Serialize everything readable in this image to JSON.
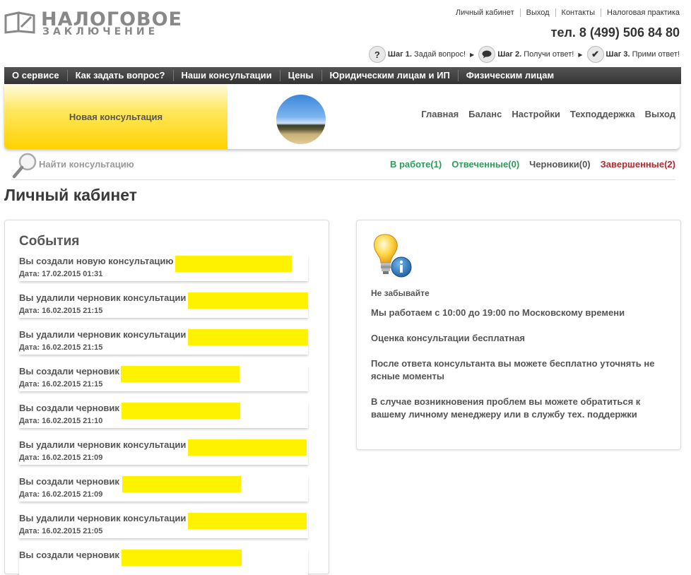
{
  "logo": {
    "line1": "НАЛОГОВОЕ",
    "line2": "ЗАКЛЮЧЕНИЕ",
    "icon": "book-pen-icon"
  },
  "top_links": [
    "Личный кабинет",
    "Выход",
    "Контакты",
    "Налоговая практика"
  ],
  "phone": "тел. 8 (499) 506 84 80",
  "steps": [
    {
      "icon": "question-icon",
      "glyph": "?",
      "label": "Шаг 1.",
      "text": "Задай вопрос!"
    },
    {
      "icon": "speech-bubble-icon",
      "glyph": "",
      "label": "Шаг 2.",
      "text": "Получи ответ!"
    },
    {
      "icon": "checkmark-icon",
      "glyph": "✔",
      "label": "Шаг 3.",
      "text": "Прими ответ!"
    }
  ],
  "main_menu": [
    "О сервисе",
    "Как задать вопрос?",
    "Наши консультации",
    "Цены",
    "Юридическим лицам и ИП",
    "Физическим лицам"
  ],
  "panel": {
    "new_consultation": "Новая консультация",
    "nav": [
      "Главная",
      "Баланс",
      "Настройки",
      "Техподдержка",
      "Выход"
    ]
  },
  "search": {
    "label": "Найти консультацию",
    "icon": "magnifier-icon"
  },
  "filters": {
    "in_work": "В работе(1)",
    "answered": "Отвеченные(0)",
    "drafts": "Черновики(0)",
    "completed": "Завершенные(2)"
  },
  "page_title": "Личный кабинет",
  "events": {
    "title": "События",
    "items": [
      {
        "text": "Вы создали новую консультацию",
        "date": "Дата: 17.02.2015 01:31"
      },
      {
        "text": "Вы удалили черновик консультации",
        "date": "Дата: 16.02.2015 21:15"
      },
      {
        "text": "Вы удалили черновик консультации",
        "date": "Дата: 16.02.2015 21:15"
      },
      {
        "text": "Вы создали черновик",
        "date": "Дата: 16.02.2015 21:15"
      },
      {
        "text": "Вы создали черновик",
        "date": "Дата: 16.02.2015 21:10"
      },
      {
        "text": "Вы удалили черновик консультации",
        "date": "Дата: 16.02.2015 21:09"
      },
      {
        "text": "Вы создали черновик",
        "date": "Дата: 16.02.2015 21:09"
      },
      {
        "text": "Вы удалили черновик консультации",
        "date": "Дата: 16.02.2015 21:05"
      },
      {
        "text": "Вы создали черновик",
        "date": ""
      }
    ]
  },
  "info": {
    "icon": "lightbulb-info-icon",
    "title": "Не забывайте",
    "paragraphs": [
      "Мы работаем с 10:00 до 19:00 по Московскому времени",
      "Оценка консультации бесплатная",
      "После ответа консультанта вы можете бесплатно уточнять не ясные моменты",
      "В случае возникновения проблем вы можете обратиться к вашему личному менеджеру или в службу тех. поддержки"
    ]
  },
  "colors": {
    "accent_yellow": "#ffd200",
    "highlight": "#fff200",
    "menubar": "#3a3a3a",
    "green": "#2a9d5a",
    "red": "#b8262e"
  }
}
